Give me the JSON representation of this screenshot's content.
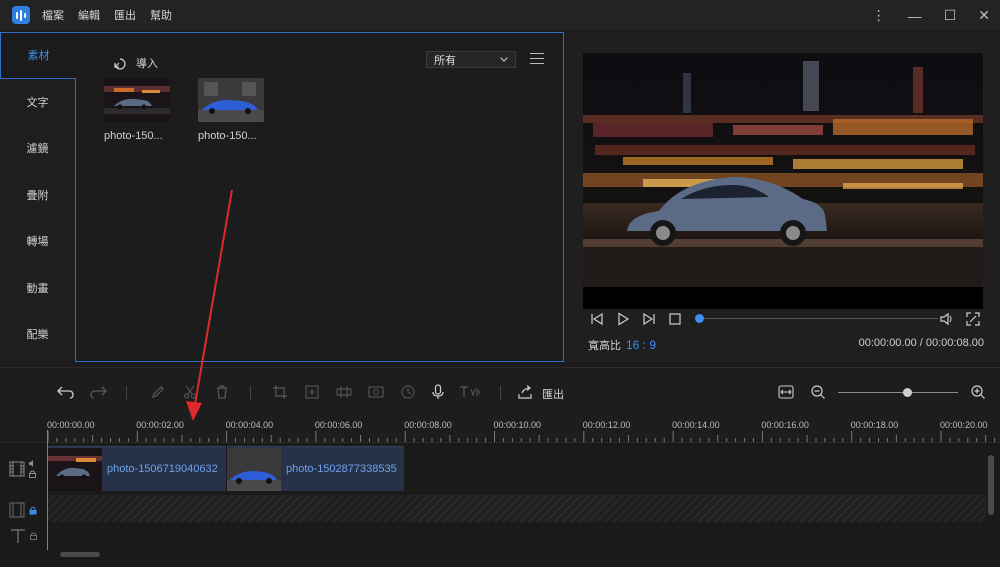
{
  "window": {
    "menu": [
      "檔案",
      "編輯",
      "匯出",
      "幫助"
    ]
  },
  "sidebar": {
    "items": [
      {
        "label": "素材",
        "active": true
      },
      {
        "label": "文字",
        "active": false
      },
      {
        "label": "濾鏡",
        "active": false
      },
      {
        "label": "疊附",
        "active": false
      },
      {
        "label": "轉場",
        "active": false
      },
      {
        "label": "動畫",
        "active": false
      },
      {
        "label": "配樂",
        "active": false
      }
    ]
  },
  "media": {
    "import_label": "導入",
    "filter_value": "所有",
    "items": [
      {
        "name": "photo-150...",
        "car_color": "#5b6b86"
      },
      {
        "name": "photo-150...",
        "car_color": "#2d5ed6"
      }
    ]
  },
  "preview": {
    "aspect_label": "寬高比",
    "aspect_value": "16 : 9",
    "timecode": "00:00:00.00 / 00:00:08.00",
    "progress": 0
  },
  "toolbar": {
    "export_label": "匯出"
  },
  "timeline": {
    "ticks": [
      "00:00:00.00",
      "00:00:02.00",
      "00:00:04.00",
      "00:00:06.00",
      "00:00:08.00",
      "00:00:10.00",
      "00:00:12.00",
      "00:00:14.00",
      "00:00:16.00",
      "00:00:18.00",
      "00:00:20.00"
    ],
    "clips": [
      {
        "label": "photo-1506719040632",
        "car_color": "#5b6b86"
      },
      {
        "label": "photo-1502877338535",
        "car_color": "#2d5ed6"
      }
    ]
  },
  "colors": {
    "accent": "#3d8ef0",
    "arrow": "#e02a2a"
  }
}
